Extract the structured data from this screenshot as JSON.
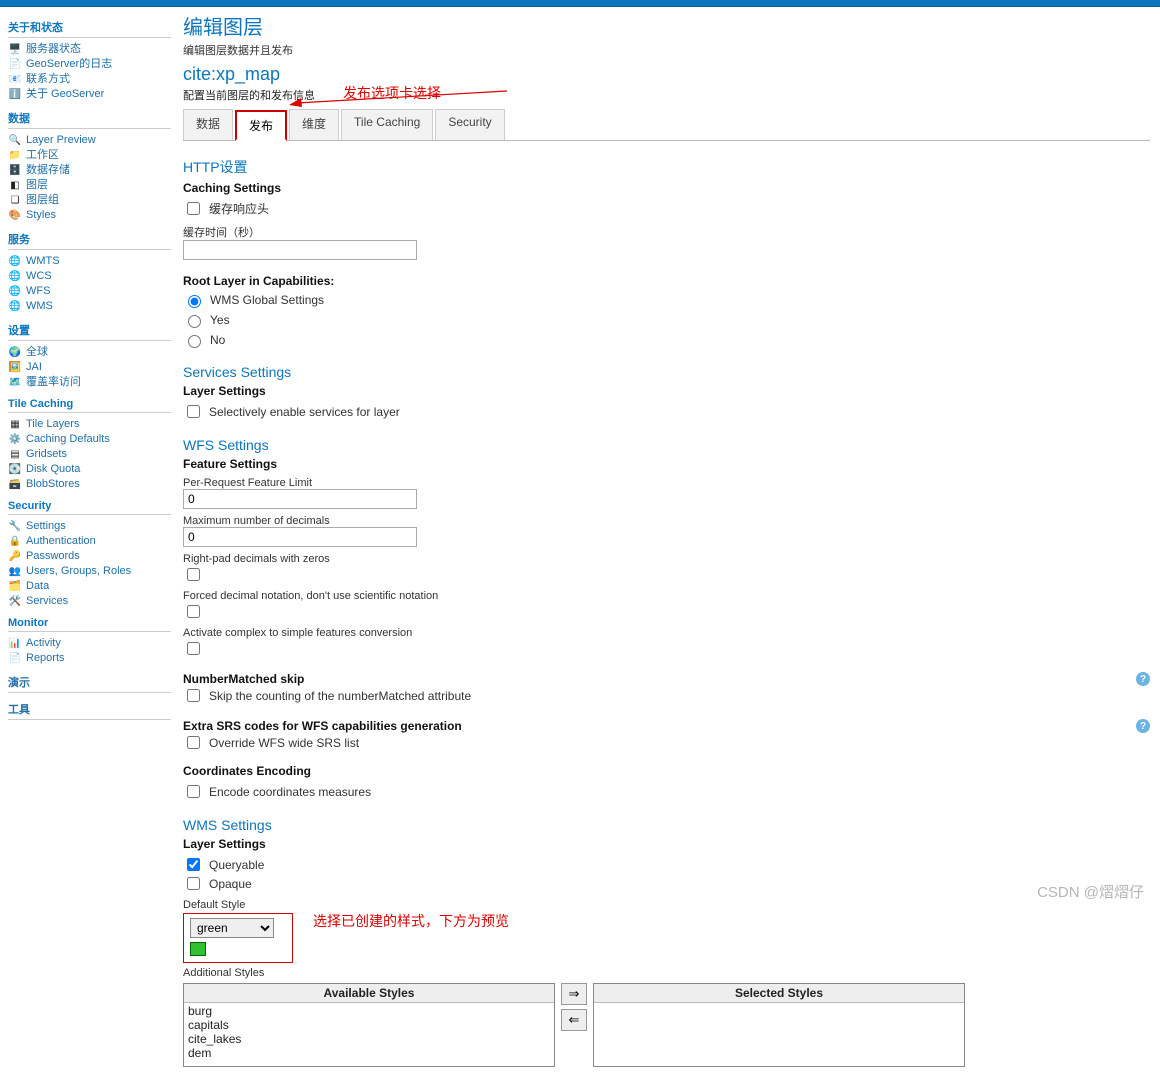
{
  "page": {
    "title": "编辑图层",
    "subtitle": "编辑图层数据并且发布",
    "layer": "cite:xp_map",
    "config_desc": "配置当前图层的和发布信息"
  },
  "tabs": {
    "data": "数据",
    "publish": "发布",
    "dimension": "维度",
    "tilecaching": "Tile Caching",
    "security": "Security"
  },
  "anno": {
    "tab_select": "发布选项卡选择",
    "style_select": "选择已创建的样式，下方为预览"
  },
  "sidebar": {
    "g1": "关于和状态",
    "g1_items": [
      "服务器状态",
      "GeoServer的日志",
      "联系方式",
      "关于 GeoServer"
    ],
    "g2": "数据",
    "g2_items": [
      "Layer Preview",
      "工作区",
      "数据存储",
      "图层",
      "图层组",
      "Styles"
    ],
    "g3": "服务",
    "g3_items": [
      "WMTS",
      "WCS",
      "WFS",
      "WMS"
    ],
    "g4": "设置",
    "g4_items": [
      "全球",
      "JAI",
      "覆盖率访问"
    ],
    "g5": "Tile Caching",
    "g5_items": [
      "Tile Layers",
      "Caching Defaults",
      "Gridsets",
      "Disk Quota",
      "BlobStores"
    ],
    "g6": "Security",
    "g6_items": [
      "Settings",
      "Authentication",
      "Passwords",
      "Users, Groups, Roles",
      "Data",
      "Services"
    ],
    "g7": "Monitor",
    "g7_items": [
      "Activity",
      "Reports"
    ],
    "g8": "演示",
    "g9": "工具"
  },
  "http": {
    "heading": "HTTP设置",
    "caching_settings": "Caching Settings",
    "cache_response": "缓存响应头",
    "cache_time_label": "缓存时间（秒）",
    "cache_time_value": ""
  },
  "rootlayer": {
    "heading": "Root Layer in Capabilities:",
    "opt_global": "WMS Global Settings",
    "opt_yes": "Yes",
    "opt_no": "No"
  },
  "services": {
    "heading": "Services Settings",
    "layer_settings": "Layer Settings",
    "selective": "Selectively enable services for layer"
  },
  "wfs": {
    "heading": "WFS Settings",
    "feature_settings": "Feature Settings",
    "per_request_label": "Per-Request Feature Limit",
    "per_request_value": "0",
    "max_dec_label": "Maximum number of decimals",
    "max_dec_value": "0",
    "rightpad": "Right-pad decimals with zeros",
    "forced": "Forced decimal notation, don't use scientific notation",
    "complex": "Activate complex to simple features conversion",
    "nm_heading": "NumberMatched skip",
    "nm_skip": "Skip the counting of the numberMatched attribute",
    "srs_heading": "Extra SRS codes for WFS capabilities generation",
    "srs_override": "Override WFS wide SRS list",
    "coord_heading": "Coordinates Encoding",
    "coord_enc": "Encode coordinates measures"
  },
  "wms": {
    "heading": "WMS Settings",
    "layer_settings": "Layer Settings",
    "queryable": "Queryable",
    "opaque": "Opaque",
    "default_style_label": "Default Style",
    "default_style_value": "green",
    "addl_styles": "Additional Styles",
    "available": "Available Styles",
    "selected": "Selected Styles",
    "avail_opts": [
      "burg",
      "capitals",
      "cite_lakes",
      "dem"
    ],
    "sel_opts": []
  },
  "footer": {
    "watermark": "CSDN @熠熠仔"
  }
}
